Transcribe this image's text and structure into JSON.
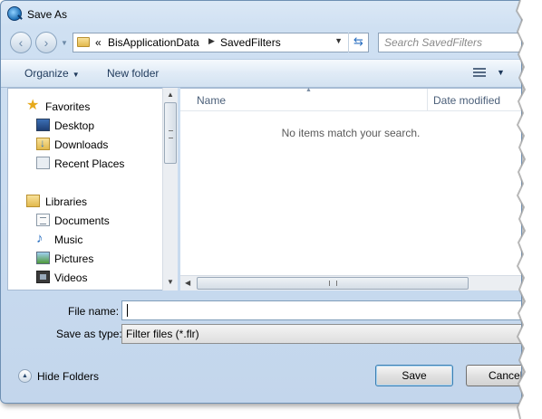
{
  "window": {
    "title": "Save As"
  },
  "address": {
    "overflow": "«",
    "crumbs": [
      "BisApplicationData",
      "SavedFilters"
    ]
  },
  "search": {
    "placeholder": "Search SavedFilters"
  },
  "toolbar": {
    "organize_label": "Organize",
    "new_folder_label": "New folder"
  },
  "sidebar": {
    "favorites_label": "Favorites",
    "favorites": [
      "Desktop",
      "Downloads",
      "Recent Places"
    ],
    "libraries_label": "Libraries",
    "libraries": [
      "Documents",
      "Music",
      "Pictures",
      "Videos"
    ]
  },
  "file_list": {
    "columns": [
      "Name",
      "Date modified"
    ],
    "empty_message": "No items match your search."
  },
  "form": {
    "file_name_label": "File name:",
    "file_name_value": "",
    "save_type_label": "Save as type:",
    "save_type_value": "Filter files (*.flr)"
  },
  "footer": {
    "hide_folders_label": "Hide Folders",
    "save_label": "Save",
    "cancel_label": "Cancel"
  },
  "colors": {
    "frame": "#cfe0f2",
    "accent": "#1e395b"
  }
}
